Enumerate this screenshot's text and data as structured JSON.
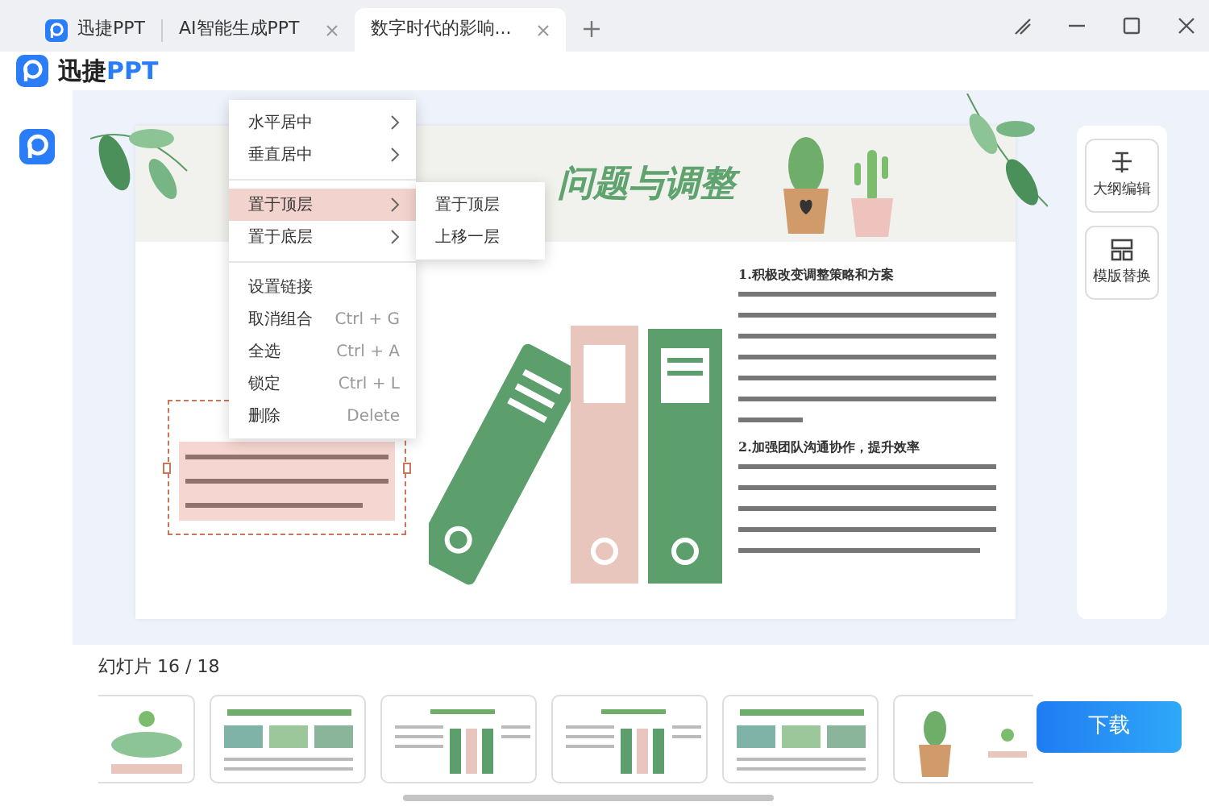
{
  "tabs": [
    {
      "label": "迅捷PPT",
      "selected": false,
      "closable": false,
      "logo": true
    },
    {
      "label": "AI智能生成PPT",
      "selected": false,
      "closable": true,
      "logo": false
    },
    {
      "label": "数字时代的影响...",
      "selected": true,
      "closable": true,
      "logo": false
    }
  ],
  "app": {
    "name_plain": "迅捷",
    "name_accent": "PPT"
  },
  "slide": {
    "title": "问题与调整",
    "headings": [
      "1.积极改变调整策略和方案",
      "2.加强团队沟通协作，提升效率"
    ],
    "textbox_selected": true
  },
  "context_menu": {
    "items": [
      {
        "kind": "item",
        "label": "水平居中",
        "submenu": true,
        "selected": false
      },
      {
        "kind": "item",
        "label": "垂直居中",
        "submenu": true,
        "selected": false
      },
      {
        "kind": "divider"
      },
      {
        "kind": "item",
        "label": "置于顶层",
        "submenu": true,
        "selected": true
      },
      {
        "kind": "item",
        "label": "置于底层",
        "submenu": true,
        "selected": false
      },
      {
        "kind": "divider"
      },
      {
        "kind": "item",
        "label": "设置链接",
        "submenu": false,
        "selected": false
      },
      {
        "kind": "item",
        "label": "取消组合",
        "shortcut": "Ctrl + G",
        "submenu": false,
        "selected": false
      },
      {
        "kind": "item",
        "label": "全选",
        "shortcut": "Ctrl + A",
        "submenu": false,
        "selected": false
      },
      {
        "kind": "item",
        "label": "锁定",
        "shortcut": "Ctrl + L",
        "submenu": false,
        "selected": false
      },
      {
        "kind": "item",
        "label": "删除",
        "shortcut": "Delete",
        "submenu": false,
        "selected": false
      }
    ],
    "submenu": [
      "置于顶层",
      "上移一层"
    ]
  },
  "side_panel": [
    {
      "label": "大纲编辑",
      "kind": "outline"
    },
    {
      "label": "模版替换",
      "kind": "template"
    }
  ],
  "slides_bar": {
    "label": "幻灯片 16 / 18"
  },
  "thumbnails": [
    {
      "kind": "section"
    },
    {
      "kind": "photos"
    },
    {
      "kind": "binders"
    },
    {
      "kind": "binders"
    },
    {
      "kind": "photos"
    },
    {
      "kind": "cactus"
    }
  ],
  "download_button": {
    "label": "下载"
  }
}
